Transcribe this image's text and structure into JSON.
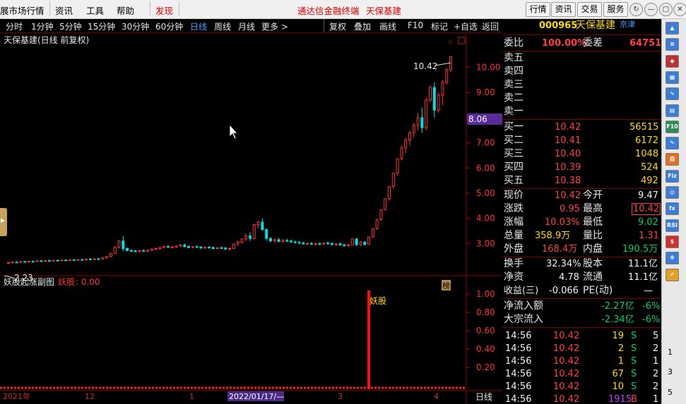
{
  "menu": {
    "items": [
      "展市场行情",
      "资讯",
      "工具",
      "帮助",
      "发现"
    ],
    "title": "通达信金融终端",
    "stock_title": "天保基建"
  },
  "right_buttons": [
    "行情",
    "资讯",
    "交易",
    "服务"
  ],
  "window_controls": [
    "↻",
    "—",
    "□",
    "✕"
  ],
  "toolbar": {
    "periods": [
      "分时",
      "1分钟",
      "5分钟",
      "15分钟",
      "30分钟",
      "60分钟",
      "日线",
      "周线",
      "月线",
      "更多 >"
    ],
    "active": "日线",
    "tools": [
      "复权",
      "叠加",
      "画线",
      "F10",
      "标记",
      "+自选",
      "返回"
    ]
  },
  "chart": {
    "title": "天保基建(日线 前复权)",
    "high_label": "10.42",
    "low_label": "2.23",
    "last_price": "8.06",
    "y_ticks": [
      "10.00",
      "9.00",
      "8.00",
      "7.00",
      "6.00",
      "5.00",
      "4.00",
      "3.00"
    ],
    "badge": "榜",
    "indicator_title": "妖股起涨副图",
    "indicator_name": "妖股",
    "indicator_value": ": 0.00",
    "signal_label": "妖股",
    "sub_ticks": [
      "1.00",
      "0.80",
      "0.60",
      "0.40",
      "0.20"
    ],
    "x_labels": [
      "2021年",
      "12",
      "1",
      "2022/01/17/—",
      "3",
      "4"
    ],
    "period_tag": "日线"
  },
  "chart_data": {
    "type": "candlestick",
    "ylim": [
      2.0,
      10.8
    ],
    "ohlc": [
      [
        2.23,
        2.27,
        2.21,
        2.24
      ],
      [
        2.24,
        2.28,
        2.22,
        2.26
      ],
      [
        2.26,
        2.29,
        2.24,
        2.25
      ],
      [
        2.25,
        2.3,
        2.24,
        2.28
      ],
      [
        2.28,
        2.31,
        2.26,
        2.27
      ],
      [
        2.27,
        2.31,
        2.25,
        2.29
      ],
      [
        2.29,
        2.32,
        2.27,
        2.28
      ],
      [
        2.28,
        2.33,
        2.27,
        2.31
      ],
      [
        2.31,
        2.34,
        2.29,
        2.3
      ],
      [
        2.3,
        2.34,
        2.28,
        2.32
      ],
      [
        2.32,
        2.35,
        2.3,
        2.31
      ],
      [
        2.31,
        2.35,
        2.29,
        2.33
      ],
      [
        2.33,
        2.36,
        2.31,
        2.32
      ],
      [
        2.32,
        2.36,
        2.3,
        2.34
      ],
      [
        2.34,
        2.37,
        2.32,
        2.33
      ],
      [
        2.33,
        2.37,
        2.31,
        2.35
      ],
      [
        2.35,
        2.38,
        2.33,
        2.34
      ],
      [
        2.34,
        2.38,
        2.32,
        2.36
      ],
      [
        2.36,
        2.39,
        2.34,
        2.35
      ],
      [
        2.35,
        2.4,
        2.33,
        2.38
      ],
      [
        2.38,
        2.42,
        2.36,
        2.37
      ],
      [
        2.37,
        2.41,
        2.35,
        2.39
      ],
      [
        2.39,
        2.43,
        2.37,
        2.38
      ],
      [
        2.38,
        2.45,
        2.36,
        2.43
      ],
      [
        2.43,
        2.5,
        2.4,
        2.48
      ],
      [
        2.48,
        2.62,
        2.45,
        2.6
      ],
      [
        2.6,
        2.9,
        2.58,
        2.85
      ],
      [
        2.85,
        3.12,
        2.8,
        3.1
      ],
      [
        3.1,
        3.3,
        2.7,
        2.8
      ],
      [
        2.8,
        2.85,
        2.68,
        2.72
      ],
      [
        2.72,
        2.76,
        2.66,
        2.7
      ],
      [
        2.7,
        2.75,
        2.65,
        2.68
      ],
      [
        2.68,
        2.74,
        2.64,
        2.72
      ],
      [
        2.72,
        2.76,
        2.66,
        2.69
      ],
      [
        2.69,
        2.75,
        2.65,
        2.73
      ],
      [
        2.73,
        2.8,
        2.7,
        2.78
      ],
      [
        2.78,
        2.84,
        2.74,
        2.8
      ],
      [
        2.8,
        2.86,
        2.76,
        2.84
      ],
      [
        2.84,
        2.92,
        2.8,
        2.88
      ],
      [
        2.88,
        2.94,
        2.82,
        2.85
      ],
      [
        2.85,
        2.9,
        2.8,
        2.86
      ],
      [
        2.86,
        2.92,
        2.82,
        2.9
      ],
      [
        2.9,
        2.98,
        2.86,
        2.94
      ],
      [
        2.94,
        3.0,
        2.84,
        2.88
      ],
      [
        2.88,
        2.92,
        2.8,
        2.84
      ],
      [
        2.84,
        2.9,
        2.8,
        2.87
      ],
      [
        2.87,
        2.92,
        2.82,
        2.86
      ],
      [
        2.86,
        2.9,
        2.78,
        2.82
      ],
      [
        2.82,
        2.88,
        2.78,
        2.85
      ],
      [
        2.85,
        2.9,
        2.8,
        2.84
      ],
      [
        2.84,
        2.88,
        2.76,
        2.8
      ],
      [
        2.8,
        2.86,
        2.76,
        2.83
      ],
      [
        2.83,
        2.88,
        2.78,
        2.82
      ],
      [
        2.82,
        2.86,
        2.74,
        2.78
      ],
      [
        2.78,
        2.84,
        2.72,
        2.8
      ],
      [
        2.8,
        3.0,
        2.78,
        2.98
      ],
      [
        2.98,
        3.1,
        2.9,
        3.05
      ],
      [
        3.05,
        3.2,
        3.0,
        3.18
      ],
      [
        3.18,
        3.4,
        3.1,
        3.3
      ],
      [
        3.3,
        3.45,
        3.1,
        3.2
      ],
      [
        3.2,
        3.8,
        3.18,
        3.75
      ],
      [
        3.75,
        3.9,
        3.6,
        3.85
      ],
      [
        3.85,
        4.0,
        3.5,
        3.55
      ],
      [
        3.55,
        3.6,
        3.1,
        3.2
      ],
      [
        3.2,
        3.25,
        3.05,
        3.1
      ],
      [
        3.1,
        3.2,
        3.02,
        3.15
      ],
      [
        3.15,
        3.22,
        3.05,
        3.08
      ],
      [
        3.08,
        3.18,
        3.02,
        3.12
      ],
      [
        3.12,
        3.2,
        3.06,
        3.1
      ],
      [
        3.1,
        3.16,
        3.02,
        3.06
      ],
      [
        3.06,
        3.12,
        3.0,
        3.04
      ],
      [
        3.04,
        3.1,
        2.98,
        3.02
      ],
      [
        3.02,
        3.08,
        2.96,
        2.98
      ],
      [
        2.98,
        3.04,
        2.94,
        3.0
      ],
      [
        3.0,
        3.06,
        2.95,
        2.97
      ],
      [
        2.97,
        3.03,
        2.93,
        2.99
      ],
      [
        2.99,
        3.05,
        2.95,
        2.98
      ],
      [
        2.98,
        3.04,
        2.94,
        3.02
      ],
      [
        3.02,
        3.08,
        2.96,
        3.0
      ],
      [
        3.0,
        3.04,
        2.92,
        2.96
      ],
      [
        2.96,
        3.02,
        2.9,
        2.98
      ],
      [
        2.98,
        3.04,
        2.92,
        2.94
      ],
      [
        2.94,
        3.0,
        2.88,
        2.92
      ],
      [
        2.92,
        2.98,
        2.86,
        2.95
      ],
      [
        2.95,
        3.2,
        2.92,
        3.18
      ],
      [
        3.18,
        3.22,
        2.9,
        2.95
      ],
      [
        2.95,
        3.1,
        2.9,
        3.05
      ],
      [
        3.05,
        3.1,
        2.92,
        2.96
      ],
      [
        2.96,
        3.26,
        2.94,
        3.26
      ],
      [
        3.26,
        3.59,
        3.24,
        3.59
      ],
      [
        3.59,
        3.95,
        3.55,
        3.95
      ],
      [
        3.95,
        4.35,
        3.9,
        4.35
      ],
      [
        4.35,
        4.78,
        4.3,
        4.78
      ],
      [
        4.78,
        5.26,
        4.7,
        5.26
      ],
      [
        5.26,
        5.79,
        5.2,
        5.79
      ],
      [
        5.79,
        6.37,
        5.7,
        6.37
      ],
      [
        6.37,
        6.9,
        6.3,
        6.8
      ],
      [
        6.8,
        7.2,
        6.6,
        7.1
      ],
      [
        7.1,
        7.5,
        6.9,
        7.4
      ],
      [
        7.4,
        7.8,
        7.2,
        7.7
      ],
      [
        7.7,
        8.2,
        7.5,
        8.0
      ],
      [
        8.0,
        8.4,
        7.4,
        7.6
      ],
      [
        7.6,
        8.8,
        7.5,
        8.7
      ],
      [
        8.7,
        9.3,
        8.6,
        9.2
      ],
      [
        9.2,
        9.4,
        8.0,
        8.3
      ],
      [
        8.3,
        9.0,
        8.2,
        8.9
      ],
      [
        8.9,
        9.5,
        8.5,
        9.4
      ],
      [
        9.4,
        10.0,
        9.3,
        9.9
      ],
      [
        9.9,
        10.42,
        9.8,
        10.42
      ]
    ],
    "signal_index": 88
  },
  "quote": {
    "code": "000965",
    "name": "天保基建",
    "tag": "京津",
    "weibi_label": "委比",
    "weibi": "100.00%",
    "weicha_label": "委差",
    "weicha": "64751",
    "sells": [
      "卖五",
      "卖四",
      "卖三",
      "卖二",
      "卖一"
    ],
    "buys": [
      {
        "label": "买一",
        "price": "10.42",
        "vol": "56515"
      },
      {
        "label": "买二",
        "price": "10.41",
        "vol": "6172"
      },
      {
        "label": "买三",
        "price": "10.40",
        "vol": "1048"
      },
      {
        "label": "买四",
        "price": "10.39",
        "vol": "524"
      },
      {
        "label": "买五",
        "price": "10.38",
        "vol": "492"
      }
    ],
    "stats": [
      {
        "l1": "现价",
        "v1": "10.42",
        "l2": "今开",
        "v2": "9.47",
        "c1": "red",
        "c2": "wht"
      },
      {
        "l1": "涨跌",
        "v1": "0.95",
        "l2": "最高",
        "v2": "10.42",
        "c1": "red",
        "c2": "red"
      },
      {
        "l1": "涨幅",
        "v1": "10.03%",
        "l2": "最低",
        "v2": "9.02",
        "c1": "red",
        "c2": "grn"
      },
      {
        "l1": "总量",
        "v1": "358.9万",
        "l2": "量比",
        "v2": "1.31",
        "c1": "yel",
        "c2": "red"
      },
      {
        "l1": "外盘",
        "v1": "168.4万",
        "l2": "内盘",
        "v2": "190.5万",
        "c1": "red",
        "c2": "grn"
      }
    ],
    "fund": [
      {
        "l1": "换手",
        "v1": "32.34%",
        "l2": "股本",
        "v2": "11.1亿"
      },
      {
        "l1": "净资",
        "v1": "4.78",
        "l2": "流通",
        "v2": "11.1亿"
      },
      {
        "l1": "收益(三)",
        "v1": "-0.066",
        "l2": "PE(动)",
        "v2": "—"
      }
    ],
    "flows": [
      {
        "label": "净流入额",
        "value": "-2.27亿",
        "pct": "-6%"
      },
      {
        "label": "大宗流入",
        "value": "-2.34亿",
        "pct": "-6%"
      }
    ],
    "ticks": [
      {
        "time": "14:56",
        "price": "10.42",
        "vol": "19",
        "side": "S",
        "n": "5"
      },
      {
        "time": "14:56",
        "price": "10.42",
        "vol": "2",
        "side": "S",
        "n": "2"
      },
      {
        "time": "14:56",
        "price": "10.42",
        "vol": "1",
        "side": "S",
        "n": "1"
      },
      {
        "time": "14:56",
        "price": "10.42",
        "vol": "67",
        "side": "S",
        "n": "2"
      },
      {
        "time": "14:56",
        "price": "10.42",
        "vol": "10",
        "side": "S",
        "n": "2"
      },
      {
        "time": "14:56",
        "price": "10.42",
        "vol": "1915",
        "side": "B",
        "n": "1"
      }
    ]
  },
  "sidebar": {
    "icons": [
      {
        "name": "up-arrow-icon",
        "glyph": "▲",
        "color": "#3c7dd8"
      },
      {
        "name": "list-icon",
        "glyph": "≡",
        "color": "#3c7dd8"
      },
      {
        "name": "flash-icon",
        "glyph": "◆",
        "color": "#c03030"
      },
      {
        "name": "grid-icon",
        "glyph": "▦",
        "color": "#3c7dd8"
      },
      {
        "name": "line-chart-icon",
        "glyph": "∿",
        "color": "#3c7dd8"
      },
      {
        "name": "table-icon",
        "glyph": "▤",
        "color": "#3c7dd8"
      },
      {
        "name": "f10-icon",
        "glyph": "F10",
        "color": "#2e8b57"
      },
      {
        "name": "note-icon",
        "glyph": "✎",
        "color": "#3c7dd8"
      },
      {
        "name": "self-icon",
        "glyph": "自",
        "color": "#e07020"
      },
      {
        "name": "fiz-icon",
        "glyph": "Fiz",
        "color": "#3c7dd8"
      },
      {
        "name": "plan-icon",
        "glyph": "◎",
        "color": "#3c7dd8"
      },
      {
        "name": "fx-icon",
        "glyph": "fx",
        "color": "#3c7dd8"
      },
      {
        "name": "rsi-icon",
        "glyph": "RSI",
        "color": "#3c7dd8"
      },
      {
        "name": "dollar-icon",
        "glyph": "$",
        "color": "#d03030"
      },
      {
        "name": "move-icon",
        "glyph": "✥",
        "color": "#3c7dd8"
      },
      {
        "name": "pencil-icon",
        "glyph": "✐",
        "color": "#e0a020"
      }
    ],
    "page_nums": [
      "1",
      "3",
      "5"
    ]
  }
}
